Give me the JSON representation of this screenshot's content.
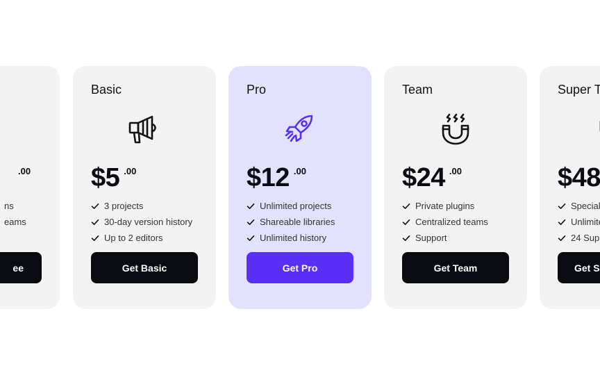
{
  "colors": {
    "card_background": "#f3f3f3",
    "featured_background": "#e2e2fd",
    "accent": "#5a2ff5",
    "button_dark": "#0a0a12",
    "text_dark": "#0b0b14"
  },
  "plans": [
    {
      "title": "",
      "icon": "shield-icon",
      "price": "",
      "cents": ".00",
      "features": [
        "ns",
        "eams"
      ],
      "cta": "ee"
    },
    {
      "title": "Basic",
      "icon": "megaphone-icon",
      "price": "$5",
      "cents": ".00",
      "features": [
        "3 projects",
        "30-day version history",
        "Up to 2 editors"
      ],
      "cta": "Get Basic"
    },
    {
      "title": "Pro",
      "icon": "rocket-icon",
      "price": "$12",
      "cents": ".00",
      "features": [
        "Unlimited projects",
        "Shareable libraries",
        "Unlimited history"
      ],
      "cta": "Get Pro"
    },
    {
      "title": "Team",
      "icon": "magnet-icon",
      "price": "$24",
      "cents": ".00",
      "features": [
        "Private plugins",
        "Centralized teams",
        "Support"
      ],
      "cta": "Get Team"
    },
    {
      "title": "Super T",
      "icon": "shield-icon",
      "price": "$48",
      "cents": "",
      "features": [
        "Special",
        "Unlimite",
        "24 Supp"
      ],
      "cta": "Get S"
    }
  ]
}
